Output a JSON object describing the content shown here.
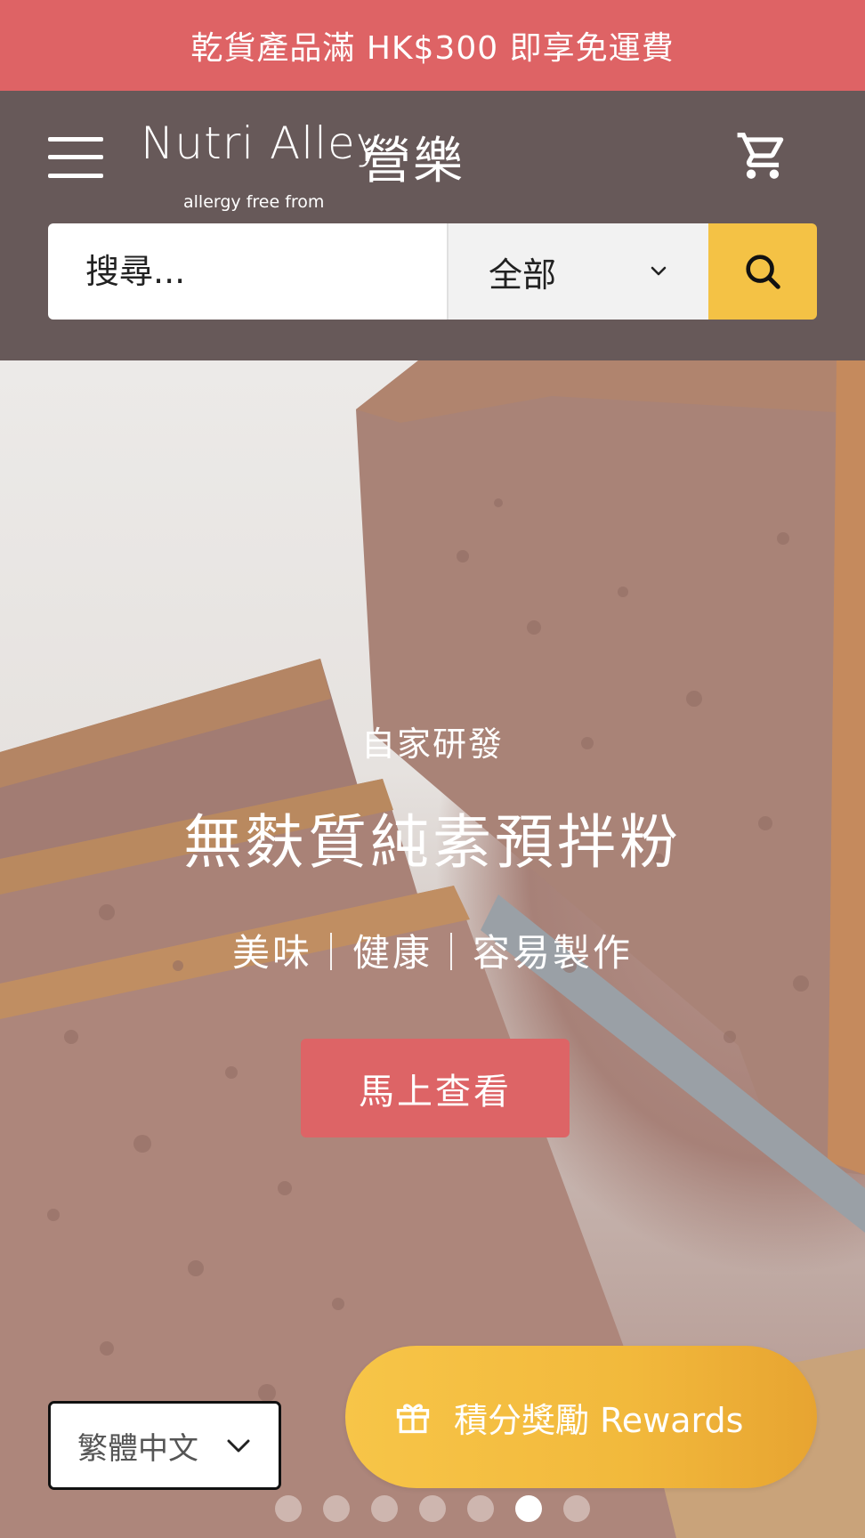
{
  "announcement": {
    "text": "乾貨產品滿 HK$300 即享免運費"
  },
  "header": {
    "logo": {
      "wordmark": "Nutri Alley",
      "chinese": "營樂",
      "tagline": "allergy free from"
    },
    "menu_icon": "hamburger-icon",
    "cart_icon": "cart-icon"
  },
  "search": {
    "placeholder": "搜尋...",
    "category_selected": "全部",
    "button_icon": "search-icon"
  },
  "hero": {
    "eyebrow": "自家研發",
    "title": "無麩質純素預拌粉",
    "tagline": "美味｜健康｜容易製作",
    "cta_label": "馬上查看"
  },
  "carousel": {
    "total_slides": 7,
    "active_index": 5
  },
  "language": {
    "selected": "繁體中文"
  },
  "rewards": {
    "label": "積分獎勵 Rewards",
    "icon": "gift-icon"
  },
  "colors": {
    "announcement_bg": "#de6365",
    "header_bg": "#675959",
    "search_button": "#f4c245",
    "cta_bg": "#dd6466",
    "rewards_bg": "#f4c245"
  }
}
